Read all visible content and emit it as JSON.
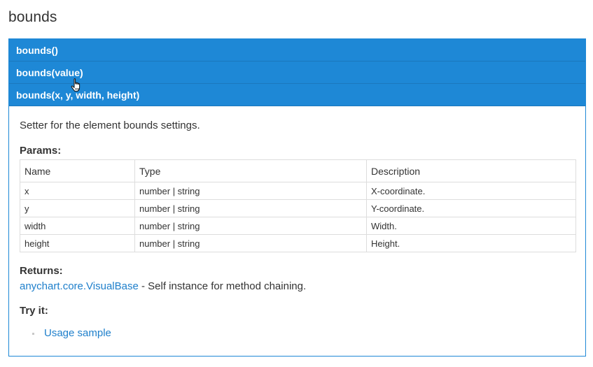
{
  "page": {
    "title": "bounds"
  },
  "overloads": [
    {
      "label": "bounds()"
    },
    {
      "label": "bounds(value)"
    },
    {
      "label": "bounds(x, y, width, height)"
    }
  ],
  "details": {
    "description": "Setter for the element bounds settings.",
    "params_heading": "Params:",
    "params_table": {
      "headers": [
        "Name",
        "Type",
        "Description"
      ],
      "rows": [
        [
          "x",
          "number | string",
          "X-coordinate."
        ],
        [
          "y",
          "number | string",
          "Y-coordinate."
        ],
        [
          "width",
          "number | string",
          "Width."
        ],
        [
          "height",
          "number | string",
          "Height."
        ]
      ]
    },
    "returns_heading": "Returns:",
    "returns_link": "anychart.core.VisualBase",
    "returns_text": " - Self instance for method chaining.",
    "try_heading": "Try it:",
    "try_links": [
      "Usage sample"
    ]
  },
  "icons": {
    "cursor": "hand-pointer-icon",
    "bullet": "square-bullet-icon"
  },
  "colors": {
    "accent": "#1e88d6",
    "link": "#1e7fcb",
    "text": "#333333",
    "table_border": "#dddddd"
  }
}
